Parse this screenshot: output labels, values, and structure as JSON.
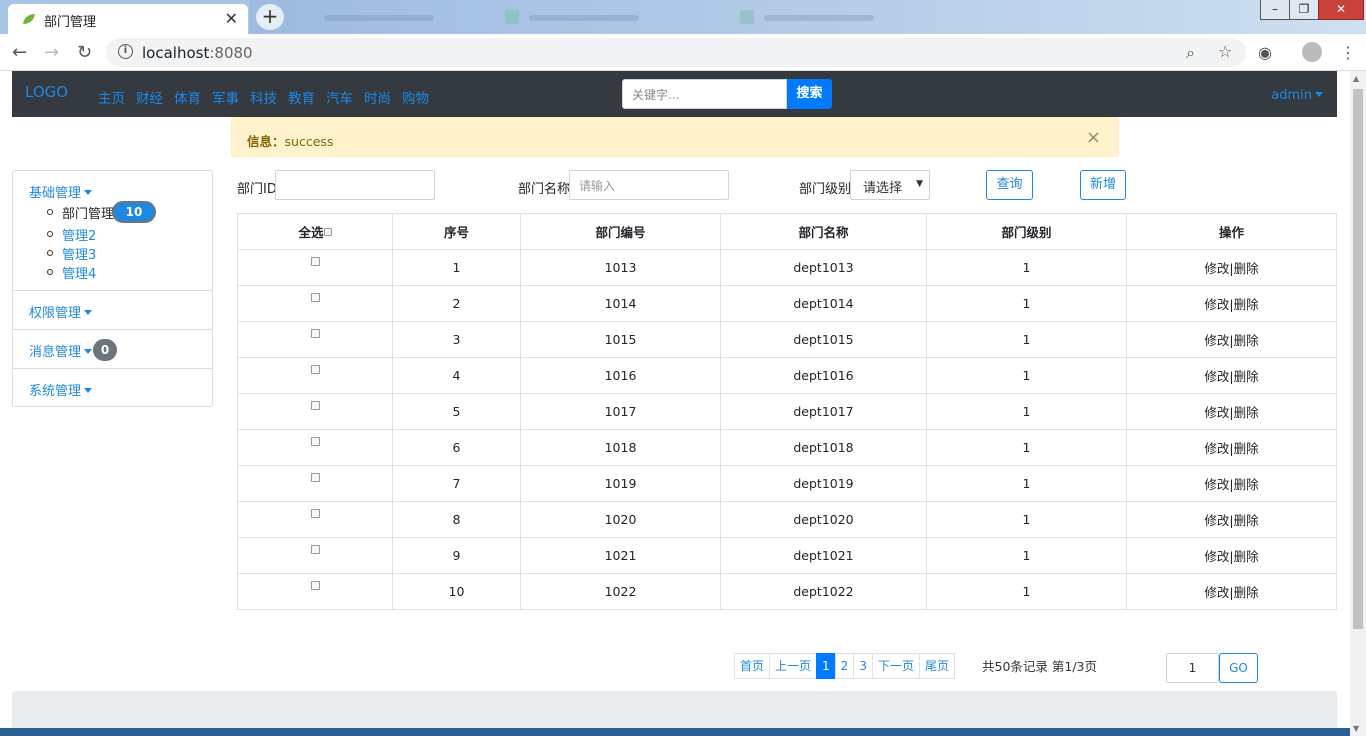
{
  "browser": {
    "tab_title": "部门管理",
    "url_host": "localhost",
    "url_port": ":8080"
  },
  "navbar": {
    "logo": "LOGO",
    "menu": [
      "主页",
      "财经",
      "体育",
      "军事",
      "科技",
      "教育",
      "汽车",
      "时尚",
      "购物"
    ],
    "search_placeholder": "关键字...",
    "search_button": "搜索",
    "user": "admin"
  },
  "alert": {
    "label": "信息：",
    "message": "success",
    "close": "×"
  },
  "sidebar": {
    "groups": [
      {
        "label": "基础管理",
        "items": [
          "部门管理",
          "管理2",
          "管理3",
          "管理4"
        ],
        "badge": "10"
      },
      {
        "label": "权限管理"
      },
      {
        "label": "消息管理",
        "badge": "0"
      },
      {
        "label": "系统管理"
      }
    ]
  },
  "filter": {
    "id_label": "部门ID",
    "name_label": "部门名称",
    "name_placeholder": "请输入",
    "level_label": "部门级别",
    "level_value": "请选择",
    "query_button": "查询",
    "add_button": "新增"
  },
  "table": {
    "headers": [
      "全选",
      "序号",
      "部门编号",
      "部门名称",
      "部门级别",
      "操作"
    ],
    "rows": [
      [
        "1",
        "1013",
        "dept1013",
        "1"
      ],
      [
        "2",
        "1014",
        "dept1014",
        "1"
      ],
      [
        "3",
        "1015",
        "dept1015",
        "1"
      ],
      [
        "4",
        "1016",
        "dept1016",
        "1"
      ],
      [
        "5",
        "1017",
        "dept1017",
        "1"
      ],
      [
        "6",
        "1018",
        "dept1018",
        "1"
      ],
      [
        "7",
        "1019",
        "dept1019",
        "1"
      ],
      [
        "8",
        "1020",
        "dept1020",
        "1"
      ],
      [
        "9",
        "1021",
        "dept1021",
        "1"
      ],
      [
        "10",
        "1022",
        "dept1022",
        "1"
      ]
    ],
    "action_edit": "修改",
    "action_sep": "|",
    "action_delete": "删除"
  },
  "pagination": {
    "first": "首页",
    "prev": "上一页",
    "pages": [
      "1",
      "2",
      "3"
    ],
    "next": "下一页",
    "last": "尾页",
    "summary": "共50条记录 第1/3页",
    "go_value": "1",
    "go_button": "GO"
  }
}
